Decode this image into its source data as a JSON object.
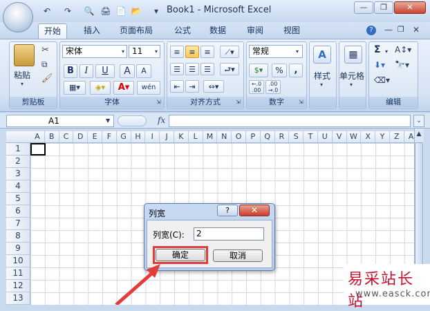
{
  "window": {
    "title": "Book1 - Microsoft Excel"
  },
  "quick_access": {
    "undo": "↶",
    "redo": "↷",
    "print_preview": "🔍",
    "print": "🖨",
    "new": "📄",
    "open": "📂",
    "customize": "▾"
  },
  "tabs": [
    "开始",
    "插入",
    "页面布局",
    "公式",
    "数据",
    "审阅",
    "视图"
  ],
  "ribbon": {
    "clipboard": {
      "paste": "粘贴",
      "label": "剪贴板"
    },
    "font": {
      "name": "宋体",
      "size": "11",
      "bold": "B",
      "italic": "I",
      "underline": "U",
      "grow": "A",
      "shrink": "A",
      "wen": "wén",
      "label": "字体"
    },
    "alignment": {
      "label": "对齐方式"
    },
    "number": {
      "format": "常规",
      "percent": "%",
      "comma": ",",
      "inc": "←.0 .00",
      "dec": ".00 →.0",
      "label": "数字"
    },
    "styles": {
      "label": "样式"
    },
    "cells": {
      "label": "单元格"
    },
    "editing": {
      "sigma": "Σ",
      "label": "编辑"
    }
  },
  "formula_bar": {
    "name_box": "A1",
    "fx": "fx"
  },
  "columns": [
    "A",
    "B",
    "C",
    "D",
    "E",
    "F",
    "G",
    "H",
    "I",
    "J",
    "K",
    "L",
    "M",
    "N",
    "O",
    "P",
    "Q",
    "R",
    "S",
    "T",
    "U",
    "V",
    "W",
    "X",
    "Y",
    "Z",
    "A"
  ],
  "rows": [
    "1",
    "2",
    "3",
    "4",
    "5",
    "6",
    "7",
    "8",
    "9",
    "10",
    "11",
    "12",
    "13"
  ],
  "dialog": {
    "title": "列宽",
    "help": "?",
    "close": "✕",
    "label": "列宽(C):",
    "value": "2",
    "ok": "确定",
    "cancel": "取消"
  },
  "watermark": {
    "text": "易采站长站",
    "url": "www.easck.com"
  }
}
